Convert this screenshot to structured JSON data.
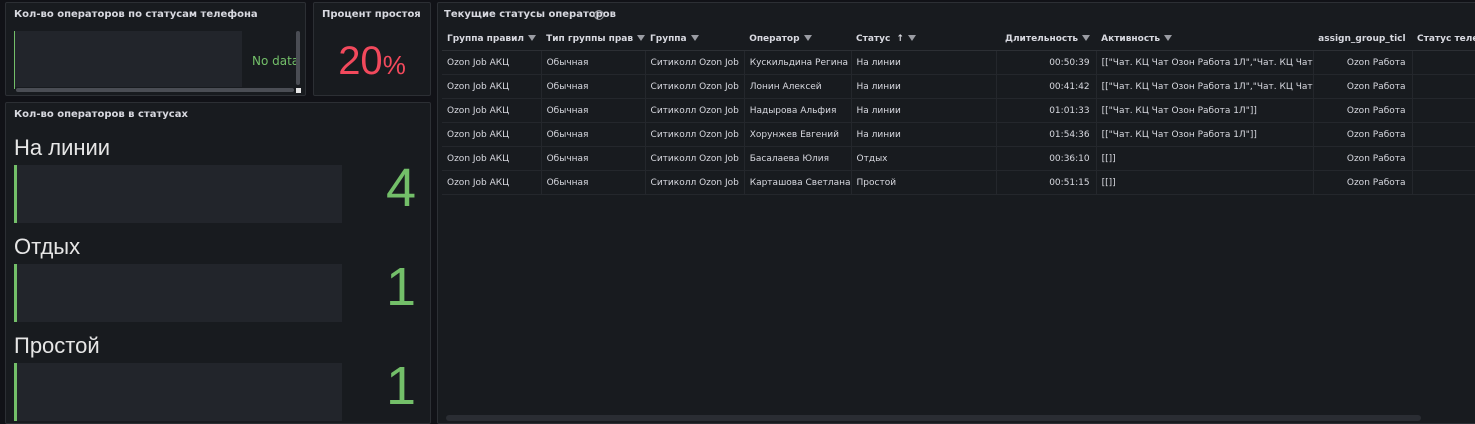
{
  "panels": {
    "phone_status": {
      "title": "Кол-во операторов по статусам телефона",
      "no_data": "No data"
    },
    "idle_percent": {
      "title": "Процент простоя",
      "value": "20",
      "unit": "%"
    },
    "operators_in_status": {
      "title": "Кол-во операторов в статусах",
      "items": [
        {
          "label": "На линии",
          "value": "4"
        },
        {
          "label": "Отдых",
          "value": "1"
        },
        {
          "label": "Простой",
          "value": "1"
        }
      ]
    },
    "current_statuses": {
      "title": "Текущие статусы операторов",
      "columns": [
        "Группа правил",
        "Тип группы прав",
        "Группа",
        "Оператор",
        "Статус",
        "Длительность",
        "Активность",
        "assign_group_ticl",
        "Статус теле"
      ],
      "rows": [
        [
          "Ozon Job АКЦ",
          "Обычная",
          "Ситиколл Ozon Job",
          "Кускильдина Регина",
          "На линии",
          "00:50:39",
          "[[\"Чат. КЦ Чат Озон Работа 1Л\",\"Чат. КЦ Чат",
          "Ozon Работа",
          ""
        ],
        [
          "Ozon Job АКЦ",
          "Обычная",
          "Ситиколл Ozon Job",
          "Лонин Алексей",
          "На линии",
          "00:41:42",
          "[[\"Чат. КЦ Чат Озон Работа 1Л\",\"Чат. КЦ Чат",
          "Ozon Работа",
          ""
        ],
        [
          "Ozon Job АКЦ",
          "Обычная",
          "Ситиколл Ozon Job",
          "Надырова Альфия",
          "На линии",
          "01:01:33",
          "[[\"Чат. КЦ Чат Озон Работа 1Л\"]]",
          "Ozon Работа",
          ""
        ],
        [
          "Ozon Job АКЦ",
          "Обычная",
          "Ситиколл Ozon Job",
          "Хорунжев Евгений",
          "На линии",
          "01:54:36",
          "[[\"Чат. КЦ Чат Озон Работа 1Л\"]]",
          "Ozon Работа",
          ""
        ],
        [
          "Ozon Job АКЦ",
          "Обычная",
          "Ситиколл Ozon Job",
          "Басалаева Юлия",
          "Отдых",
          "00:36:10",
          "[[]]",
          "Ozon Работа",
          ""
        ],
        [
          "Ozon Job АКЦ",
          "Обычная",
          "Ситиколл Ozon Job",
          "Карташова Светлана",
          "Простой",
          "00:51:15",
          "[[]]",
          "Ozon Работа",
          ""
        ]
      ]
    }
  },
  "colors": {
    "green": "#73bf69",
    "red": "#f2495c",
    "bg": "#111217",
    "panel": "#181b1f"
  }
}
